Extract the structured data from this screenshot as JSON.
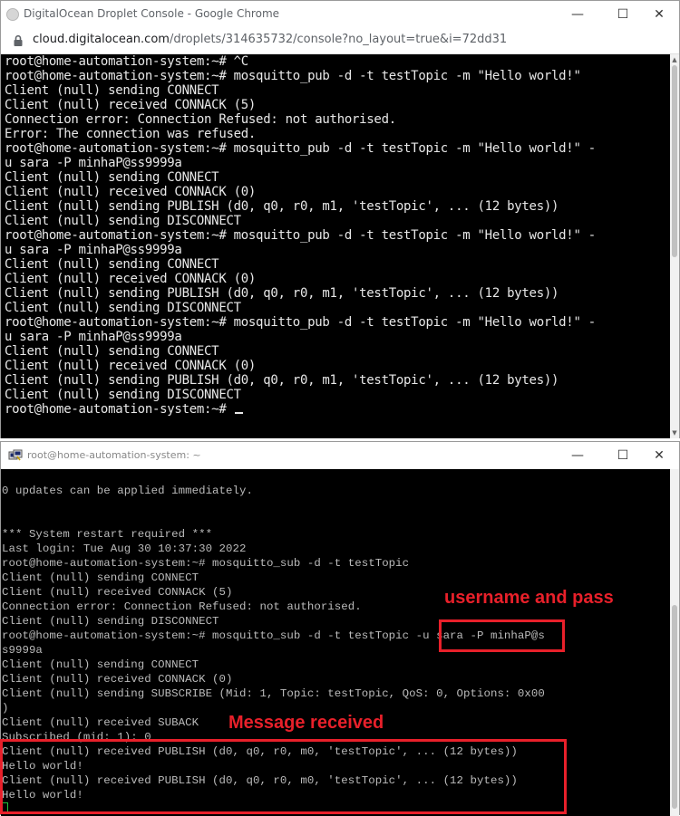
{
  "chrome": {
    "title": "DigitalOcean Droplet Console - Google Chrome",
    "url_host": "cloud.digitalocean.com",
    "url_path": "/droplets/314635732/console?no_layout=true&i=72dd31",
    "controls": {
      "minimize": "—",
      "maximize": "☐",
      "close": "✕"
    }
  },
  "droplet_console": {
    "lines": [
      "root@home-automation-system:~# ^C",
      "root@home-automation-system:~# mosquitto_pub -d -t testTopic -m \"Hello world!\"",
      "Client (null) sending CONNECT",
      "Client (null) received CONNACK (5)",
      "Connection error: Connection Refused: not authorised.",
      "Error: The connection was refused.",
      "root@home-automation-system:~# mosquitto_pub -d -t testTopic -m \"Hello world!\" -",
      "u sara -P minhaP@ss9999a",
      "Client (null) sending CONNECT",
      "Client (null) received CONNACK (0)",
      "Client (null) sending PUBLISH (d0, q0, r0, m1, 'testTopic', ... (12 bytes))",
      "Client (null) sending DISCONNECT",
      "root@home-automation-system:~# mosquitto_pub -d -t testTopic -m \"Hello world!\" -",
      "u sara -P minhaP@ss9999a",
      "Client (null) sending CONNECT",
      "Client (null) received CONNACK (0)",
      "Client (null) sending PUBLISH (d0, q0, r0, m1, 'testTopic', ... (12 bytes))",
      "Client (null) sending DISCONNECT",
      "root@home-automation-system:~# mosquitto_pub -d -t testTopic -m \"Hello world!\" -",
      "u sara -P minhaP@ss9999a",
      "Client (null) sending CONNECT",
      "Client (null) received CONNACK (0)",
      "Client (null) sending PUBLISH (d0, q0, r0, m1, 'testTopic', ... (12 bytes))",
      "Client (null) sending DISCONNECT"
    ],
    "prompt": "root@home-automation-system:~# "
  },
  "putty": {
    "title": "root@home-automation-system: ~",
    "controls": {
      "minimize": "—",
      "maximize": "☐",
      "close": "✕"
    },
    "lines": [
      "",
      "0 updates can be applied immediately.",
      "",
      "",
      "*** System restart required ***",
      "Last login: Tue Aug 30 10:37:30 2022",
      "root@home-automation-system:~# mosquitto_sub -d -t testTopic",
      "Client (null) sending CONNECT",
      "Client (null) received CONNACK (5)",
      "Connection error: Connection Refused: not authorised.",
      "Client (null) sending DISCONNECT",
      "root@home-automation-system:~# mosquitto_sub -d -t testTopic -u sara -P minhaP@s",
      "s9999a",
      "Client (null) sending CONNECT",
      "Client (null) received CONNACK (0)",
      "Client (null) sending SUBSCRIBE (Mid: 1, Topic: testTopic, QoS: 0, Options: 0x00",
      ")",
      "Client (null) received SUBACK",
      "Subscribed (mid: 1): 0",
      "Client (null) received PUBLISH (d0, q0, r0, m0, 'testTopic', ... (12 bytes))",
      "Hello world!",
      "Client (null) received PUBLISH (d0, q0, r0, m0, 'testTopic', ... (12 bytes))",
      "Hello world!"
    ]
  },
  "annotations": {
    "username_label": "username and pass",
    "message_label": "Message received",
    "color": "#e8202a"
  }
}
